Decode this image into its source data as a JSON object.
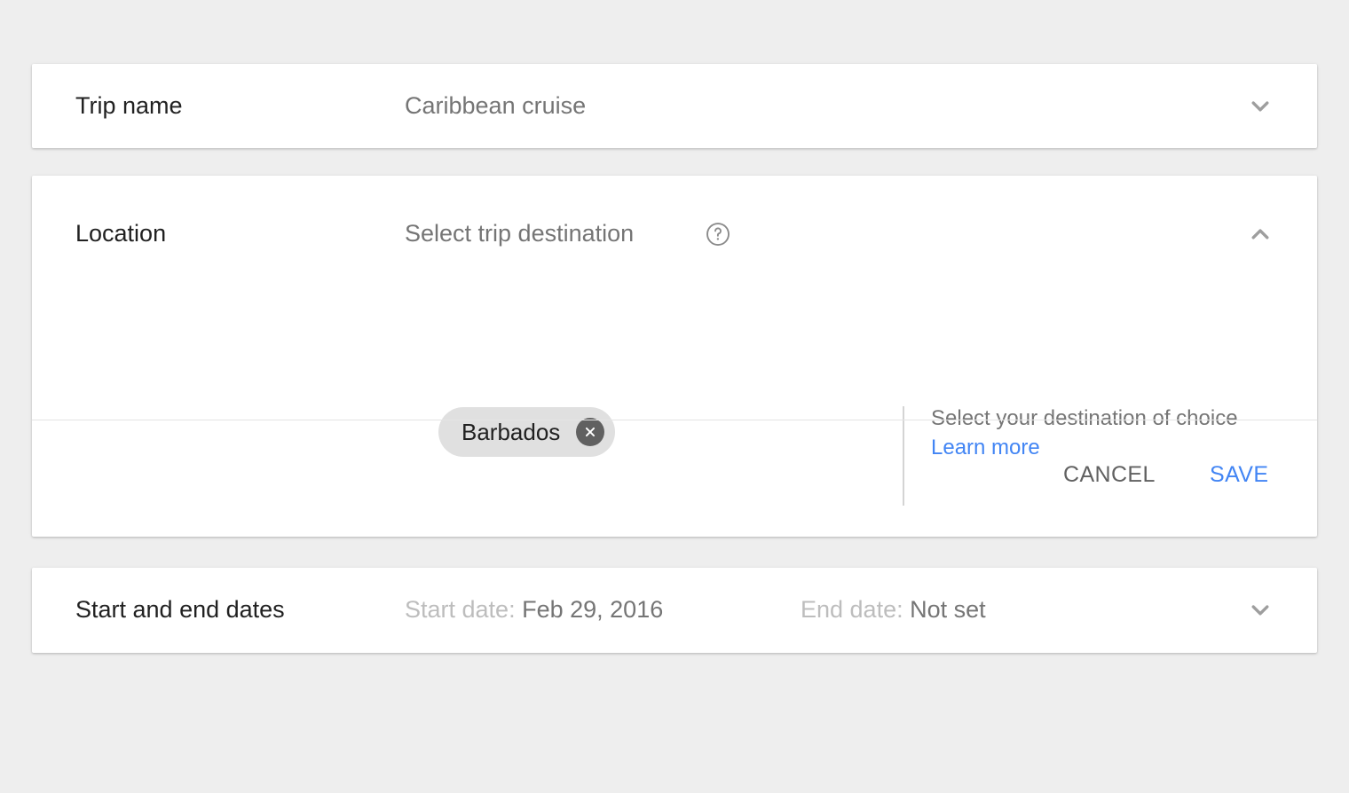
{
  "theme": {
    "background": "#eeeeee",
    "card_background": "#ffffff",
    "accent_blue": "#4285f4",
    "label_color": "#212121",
    "value_color": "#757575",
    "muted_color": "#bdbdbd",
    "chip_background": "#e0e0e0",
    "chip_remove_background": "#616161",
    "divider_color": "#e4e4e4"
  },
  "cards": {
    "trip_name": {
      "label": "Trip name",
      "value": "Caribbean cruise",
      "expand_icon": "chevron-down-icon"
    },
    "location": {
      "label": "Location",
      "value": "Select trip destination",
      "help_icon": "help-circle-icon",
      "collapse_icon": "chevron-up-icon",
      "chips": [
        {
          "label": "Barbados",
          "remove_icon": "close-circle-icon"
        }
      ],
      "helper": {
        "text": "Select your destination of choice",
        "link": "Learn more"
      },
      "actions": {
        "cancel": "CANCEL",
        "save": "SAVE"
      }
    },
    "dates": {
      "label": "Start and end dates",
      "start_label": "Start date:",
      "start_value": "Feb 29, 2016",
      "end_label": "End date:",
      "end_value": "Not set",
      "expand_icon": "chevron-down-icon"
    }
  }
}
